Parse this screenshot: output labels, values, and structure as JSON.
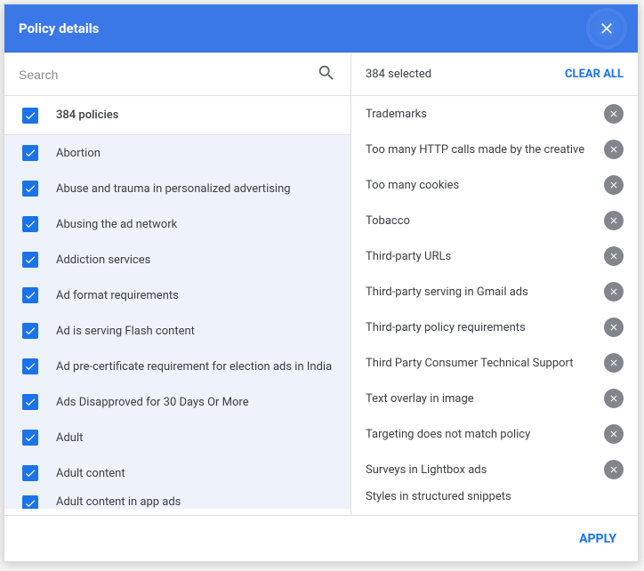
{
  "header": {
    "title": "Policy details"
  },
  "search": {
    "placeholder": "Search"
  },
  "left": {
    "all_label": "384 policies",
    "items": [
      "Abortion",
      "Abuse and trauma in personalized advertising",
      "Abusing the ad network",
      "Addiction services",
      "Ad format requirements",
      "Ad is serving Flash content",
      "Ad pre-certificate requirement for election ads in India",
      "Ads Disapproved for 30 Days Or More",
      "Adult",
      "Adult content",
      "Adult content in app ads"
    ]
  },
  "right": {
    "selected_label": "384 selected",
    "clear_all": "CLEAR ALL",
    "chips": [
      "Trademarks",
      "Too many HTTP calls made by the creative",
      "Too many cookies",
      "Tobacco",
      "Third-party URLs",
      "Third-party serving in Gmail ads",
      "Third-party policy requirements",
      "Third Party Consumer Technical Support",
      "Text overlay in image",
      "Targeting does not match policy",
      "Surveys in Lightbox ads",
      "Styles in structured snippets"
    ]
  },
  "footer": {
    "apply": "APPLY"
  }
}
